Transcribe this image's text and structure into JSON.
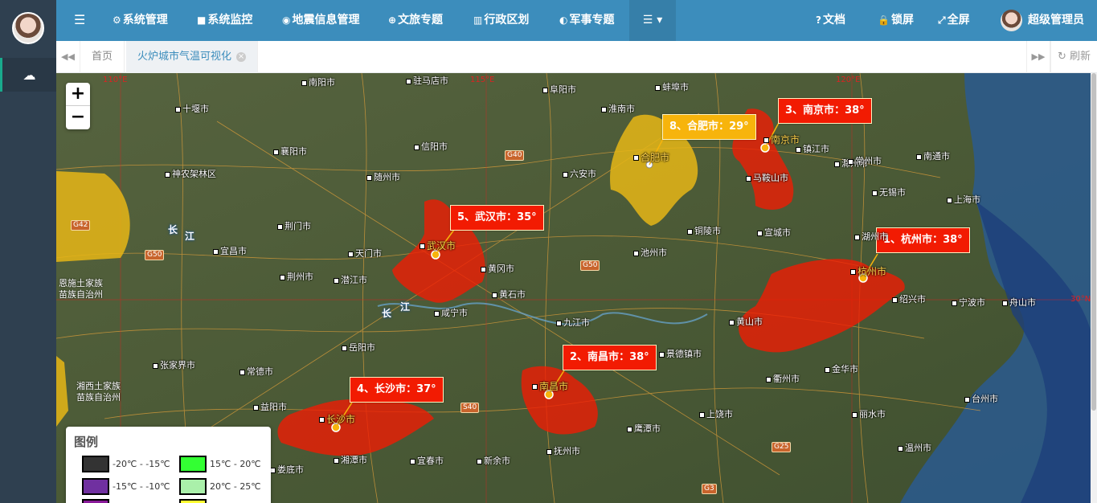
{
  "sidebar": {
    "avatar": "avatar",
    "nav_icon": "☁"
  },
  "topbar": {
    "menu_icon": "☰",
    "items": [
      {
        "icon": "⚙",
        "label": "系统管理"
      },
      {
        "icon": "■",
        "label": "系统监控"
      },
      {
        "icon": "◉",
        "label": "地震信息管理"
      },
      {
        "icon": "⊕",
        "label": "文旅专题"
      },
      {
        "icon": "▥",
        "label": "行政区划"
      },
      {
        "icon": "◐",
        "label": "军事专题"
      }
    ],
    "more_label": "☰ ▾",
    "right_items": [
      {
        "icon": "?",
        "label": "文档"
      },
      {
        "icon": "🔒",
        "label": "锁屏"
      },
      {
        "icon": "⤢",
        "label": "全屏"
      }
    ],
    "user_name": "超级管理员"
  },
  "tabs": {
    "prev_icon": "◀◀",
    "home": "首页",
    "active": "火炉城市气温可视化",
    "close_icon": "×",
    "next_icon": "▶▶",
    "refresh_icon": "↻",
    "refresh": "刷新"
  },
  "zoom": {
    "in": "+",
    "out": "−"
  },
  "hot_cities": [
    {
      "rank": "1、",
      "name": "杭州市",
      "temp": "38",
      "unit": "°",
      "color": "#f21b02"
    },
    {
      "rank": "2、",
      "name": "南昌市",
      "temp": "38",
      "unit": "°",
      "color": "#f21b02"
    },
    {
      "rank": "3、",
      "name": "南京市",
      "temp": "38",
      "unit": "°",
      "color": "#f21b02"
    },
    {
      "rank": "4、",
      "name": "长沙市",
      "temp": "37",
      "unit": "°",
      "color": "#f21b02"
    },
    {
      "rank": "5、",
      "name": "武汉市",
      "temp": "35",
      "unit": "°",
      "color": "#f21b02"
    },
    {
      "rank": "8、",
      "name": "合肥市",
      "temp": "29",
      "unit": "°",
      "color": "#f7b40c"
    }
  ],
  "map_labels": {
    "cities": [
      "南阳市",
      "驻马店市",
      "阜阳市",
      "蚌埠市",
      "十堰市",
      "淮南市",
      "襄阳市",
      "信阳市",
      "滁州市",
      "镇江市",
      "常州市",
      "南通市",
      "神农架林区",
      "随州市",
      "六安市",
      "合肥市",
      "南京市",
      "马鞍山市",
      "无锡市",
      "上海市",
      "宜昌市",
      "荆门市",
      "天门市",
      "铜陵市",
      "宣城市",
      "湖州市",
      "池州市",
      "黄冈市",
      "荆州市",
      "潜江市",
      "武汉市",
      "黄石市",
      "咸宁市",
      "九江市",
      "黄山市",
      "杭州市",
      "绍兴市",
      "宁波市",
      "舟山市",
      "岳阳市",
      "景德镇市",
      "常德市",
      "张家界市",
      "南昌市",
      "衢州市",
      "金华市",
      "台州市",
      "益阳市",
      "鹰潭市",
      "上饶市",
      "丽水市",
      "长沙市",
      "湘潭市",
      "宜春市",
      "新余市",
      "抚州市",
      "娄底市",
      "温州市"
    ],
    "roads": [
      "G40",
      "G42",
      "G50",
      "G50",
      "S40",
      "G25",
      "G3"
    ],
    "rivers": [
      "长",
      "江",
      "长",
      "江"
    ],
    "regions": [
      "恩施土家族",
      "苗族自治州",
      "湘西土家族",
      "苗族自治州"
    ],
    "coords": [
      "110°E",
      "115°E",
      "120°E",
      "30°N"
    ]
  },
  "legend": {
    "title": "图例",
    "items": [
      {
        "range": "-20℃ - -15℃",
        "color": "#333333"
      },
      {
        "range": "15℃ - 20℃",
        "color": "#33ff33"
      },
      {
        "range": "-15℃ - -10℃",
        "color": "#7030a0"
      },
      {
        "range": "20℃ - 25℃",
        "color": "#aaf0aa"
      },
      {
        "range": "",
        "color": "#8a1a9a"
      },
      {
        "range": "",
        "color": "#ffff33"
      }
    ]
  }
}
